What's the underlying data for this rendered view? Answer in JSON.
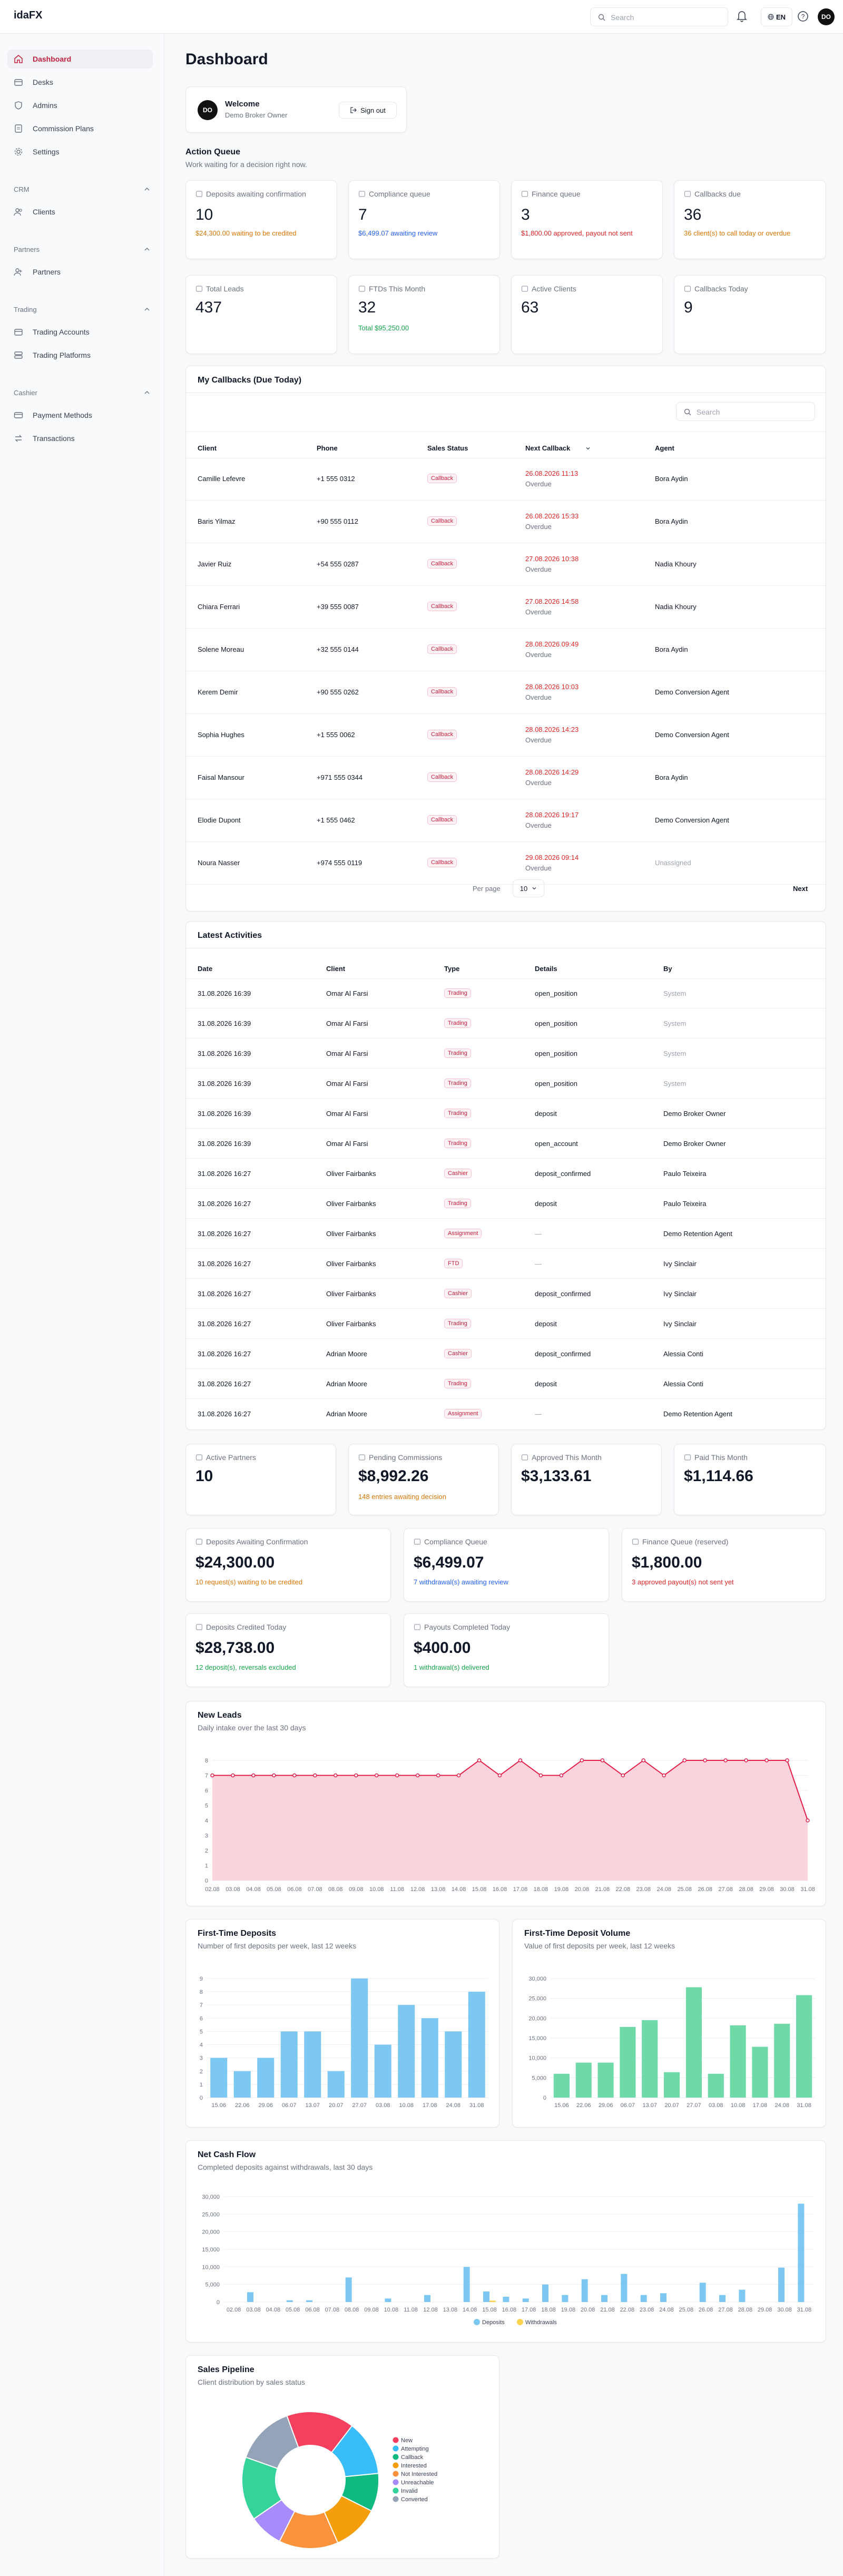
{
  "app": {
    "logo": "idaFX",
    "search_placeholder": "Search",
    "lang": "EN",
    "user_initials": "DO"
  },
  "sidebar": {
    "top": [
      {
        "label": "Dashboard"
      },
      {
        "label": "Desks"
      },
      {
        "label": "Admins"
      },
      {
        "label": "Commission Plans"
      },
      {
        "label": "Settings"
      }
    ],
    "crm": {
      "title": "CRM",
      "items": [
        {
          "label": "Clients"
        }
      ]
    },
    "partners": {
      "title": "Partners",
      "items": [
        {
          "label": "Partners"
        }
      ]
    },
    "trading": {
      "title": "Trading",
      "items": [
        {
          "label": "Trading Accounts"
        },
        {
          "label": "Trading Platforms"
        }
      ]
    },
    "cashier": {
      "title": "Cashier",
      "items": [
        {
          "label": "Payment Methods"
        },
        {
          "label": "Transactions"
        }
      ]
    }
  },
  "page": {
    "title": "Dashboard"
  },
  "welcome": {
    "title": "Welcome",
    "subtitle": "Demo Broker Owner",
    "initials": "DO",
    "signout": "Sign out"
  },
  "action_queue": {
    "title": "Action Queue",
    "subtitle": "Work waiting for a decision right now."
  },
  "queue_cards": [
    {
      "title": "Deposits awaiting confirmation",
      "value": "10",
      "sub": "$24,300.00 waiting to be credited",
      "sub_color": "orange"
    },
    {
      "title": "Compliance queue",
      "value": "7",
      "sub": "$6,499.07 awaiting review",
      "sub_color": "blue"
    },
    {
      "title": "Finance queue",
      "value": "3",
      "sub": "$1,800.00 approved, payout not sent",
      "sub_color": "red"
    },
    {
      "title": "Callbacks due",
      "value": "36",
      "sub": "36 client(s) to call today or overdue",
      "sub_color": "orange"
    }
  ],
  "kpi_cards": [
    {
      "title": "Total Leads",
      "value": "437",
      "sub": ""
    },
    {
      "title": "FTDs This Month",
      "value": "32",
      "sub": "Total $95,250.00"
    },
    {
      "title": "Active Clients",
      "value": "63",
      "sub": ""
    },
    {
      "title": "Callbacks Today",
      "value": "9",
      "sub": ""
    }
  ],
  "callbacks": {
    "title": "My Callbacks (Due Today)",
    "search_placeholder": "Search",
    "columns": [
      "Client",
      "Phone",
      "Sales Status",
      "Next Callback",
      "Agent"
    ],
    "rows": [
      {
        "client": "Camille Lefevre",
        "phone": "+1 555 0312",
        "status": "Callback",
        "date": "26.08.2026 11:13",
        "note": "Overdue",
        "agent": "Bora Aydin"
      },
      {
        "client": "Baris Yilmaz",
        "phone": "+90 555 0112",
        "status": "Callback",
        "date": "26.08.2026 15:33",
        "note": "Overdue",
        "agent": "Bora Aydin"
      },
      {
        "client": "Javier Ruiz",
        "phone": "+54 555 0287",
        "status": "Callback",
        "date": "27.08.2026 10:38",
        "note": "Overdue",
        "agent": "Nadia Khoury"
      },
      {
        "client": "Chiara Ferrari",
        "phone": "+39 555 0087",
        "status": "Callback",
        "date": "27.08.2026 14:58",
        "note": "Overdue",
        "agent": "Nadia Khoury"
      },
      {
        "client": "Solene Moreau",
        "phone": "+32 555 0144",
        "status": "Callback",
        "date": "28.08.2026 09:49",
        "note": "Overdue",
        "agent": "Bora Aydin"
      },
      {
        "client": "Kerem Demir",
        "phone": "+90 555 0262",
        "status": "Callback",
        "date": "28.08.2026 10:03",
        "note": "Overdue",
        "agent": "Demo Conversion Agent"
      },
      {
        "client": "Sophia Hughes",
        "phone": "+1 555 0062",
        "status": "Callback",
        "date": "28.08.2026 14:23",
        "note": "Overdue",
        "agent": "Demo Conversion Agent"
      },
      {
        "client": "Faisal Mansour",
        "phone": "+971 555 0344",
        "status": "Callback",
        "date": "28.08.2026 14:29",
        "note": "Overdue",
        "agent": "Bora Aydin"
      },
      {
        "client": "Elodie Dupont",
        "phone": "+1 555 0462",
        "status": "Callback",
        "date": "28.08.2026 19:17",
        "note": "Overdue",
        "agent": "Demo Conversion Agent"
      },
      {
        "client": "Noura Nasser",
        "phone": "+974 555 0119",
        "status": "Callback",
        "date": "29.08.2026 09:14",
        "note": "Overdue",
        "agent": "Unassigned"
      }
    ],
    "per_page_label": "Per page",
    "per_page": "10",
    "next": "Next"
  },
  "activities": {
    "title": "Latest Activities",
    "columns": [
      "Date",
      "Client",
      "Type",
      "Details",
      "By"
    ],
    "rows": [
      {
        "date": "31.08.2026 16:39",
        "client": "Omar Al Farsi",
        "type": "Trading",
        "details": "open_position",
        "by": "System"
      },
      {
        "date": "31.08.2026 16:39",
        "client": "Omar Al Farsi",
        "type": "Trading",
        "details": "open_position",
        "by": "System"
      },
      {
        "date": "31.08.2026 16:39",
        "client": "Omar Al Farsi",
        "type": "Trading",
        "details": "open_position",
        "by": "System"
      },
      {
        "date": "31.08.2026 16:39",
        "client": "Omar Al Farsi",
        "type": "Trading",
        "details": "open_position",
        "by": "System"
      },
      {
        "date": "31.08.2026 16:39",
        "client": "Omar Al Farsi",
        "type": "Trading",
        "details": "deposit",
        "by": "Demo Broker Owner"
      },
      {
        "date": "31.08.2026 16:39",
        "client": "Omar Al Farsi",
        "type": "Trading",
        "details": "open_account",
        "by": "Demo Broker Owner"
      },
      {
        "date": "31.08.2026 16:27",
        "client": "Oliver Fairbanks",
        "type": "Cashier",
        "details": "deposit_confirmed",
        "by": "Paulo Teixeira"
      },
      {
        "date": "31.08.2026 16:27",
        "client": "Oliver Fairbanks",
        "type": "Trading",
        "details": "deposit",
        "by": "Paulo Teixeira"
      },
      {
        "date": "31.08.2026 16:27",
        "client": "Oliver Fairbanks",
        "type": "Assignment",
        "details": "—",
        "by": "Demo Retention Agent"
      },
      {
        "date": "31.08.2026 16:27",
        "client": "Oliver Fairbanks",
        "type": "FTD",
        "details": "—",
        "by": "Ivy Sinclair"
      },
      {
        "date": "31.08.2026 16:27",
        "client": "Oliver Fairbanks",
        "type": "Cashier",
        "details": "deposit_confirmed",
        "by": "Ivy Sinclair"
      },
      {
        "date": "31.08.2026 16:27",
        "client": "Oliver Fairbanks",
        "type": "Trading",
        "details": "deposit",
        "by": "Ivy Sinclair"
      },
      {
        "date": "31.08.2026 16:27",
        "client": "Adrian Moore",
        "type": "Cashier",
        "details": "deposit_confirmed",
        "by": "Alessia Conti"
      },
      {
        "date": "31.08.2026 16:27",
        "client": "Adrian Moore",
        "type": "Trading",
        "details": "deposit",
        "by": "Alessia Conti"
      },
      {
        "date": "31.08.2026 16:27",
        "client": "Adrian Moore",
        "type": "Assignment",
        "details": "—",
        "by": "Demo Retention Agent"
      }
    ]
  },
  "partner_cards": [
    {
      "title": "Active Partners",
      "value": "10",
      "sub": ""
    },
    {
      "title": "Pending Commissions",
      "value": "$8,992.26",
      "sub": "148 entries awaiting decision"
    },
    {
      "title": "Approved This Month",
      "value": "$3,133.61",
      "sub": ""
    },
    {
      "title": "Paid This Month",
      "value": "$1,114.66",
      "sub": ""
    }
  ],
  "finance_cards": [
    {
      "title": "Deposits Awaiting Confirmation",
      "value": "$24,300.00",
      "sub": "10 request(s) waiting to be credited",
      "sub_color": "orange"
    },
    {
      "title": "Compliance Queue",
      "value": "$6,499.07",
      "sub": "7 withdrawal(s) awaiting review",
      "sub_color": "blue"
    },
    {
      "title": "Finance Queue (reserved)",
      "value": "$1,800.00",
      "sub": "3 approved payout(s) not sent yet",
      "sub_color": "red"
    },
    {
      "title": "Deposits Credited Today",
      "value": "$28,738.00",
      "sub": "12 deposit(s), reversals excluded",
      "sub_color": "green"
    },
    {
      "title": "Payouts Completed Today",
      "value": "$400.00",
      "sub": "1 withdrawal(s) delivered",
      "sub_color": "green"
    }
  ],
  "colors": {
    "accent": "#c2203f",
    "bar_blue": "#7cc8f2",
    "bar_green": "#6fd9a8",
    "line": "#e11d48",
    "area": "#fbd3dc",
    "withdraw": "#fcd34d"
  },
  "chart_data": [
    {
      "type": "area",
      "title": "New Leads",
      "subtitle": "Daily intake over the last 30 days",
      "x": [
        "02.08",
        "03.08",
        "04.08",
        "05.08",
        "06.08",
        "07.08",
        "08.08",
        "09.08",
        "10.08",
        "11.08",
        "12.08",
        "13.08",
        "14.08",
        "15.08",
        "16.08",
        "17.08",
        "18.08",
        "19.08",
        "20.08",
        "21.08",
        "22.08",
        "23.08",
        "24.08",
        "25.08",
        "26.08",
        "27.08",
        "28.08",
        "29.08",
        "30.08",
        "31.08"
      ],
      "values": [
        7,
        7,
        7,
        7,
        7,
        7,
        7,
        7,
        7,
        7,
        7,
        7,
        7,
        8,
        7,
        8,
        7,
        7,
        8,
        8,
        7,
        8,
        7,
        8,
        8,
        8,
        8,
        8,
        8,
        4
      ],
      "ylim": [
        0,
        8
      ],
      "yticks": [
        0,
        1,
        2,
        3,
        4,
        5,
        6,
        7,
        8
      ],
      "grid": true
    },
    {
      "type": "bar",
      "title": "First-Time Deposits",
      "subtitle": "Number of first deposits per week, last 12 weeks",
      "categories": [
        "15.06",
        "22.06",
        "29.06",
        "06.07",
        "13.07",
        "20.07",
        "27.07",
        "03.08",
        "10.08",
        "17.08",
        "24.08",
        "31.08"
      ],
      "values": [
        3,
        2,
        3,
        5,
        5,
        2,
        9,
        4,
        7,
        6,
        5,
        8
      ],
      "ylim": [
        0,
        9
      ],
      "yticks": [
        0,
        1,
        2,
        3,
        4,
        5,
        6,
        7,
        8,
        9
      ]
    },
    {
      "type": "bar",
      "title": "First-Time Deposit Volume",
      "subtitle": "Value of first deposits per week, last 12 weeks",
      "categories": [
        "15.06",
        "22.06",
        "29.06",
        "06.07",
        "13.07",
        "20.07",
        "27.07",
        "03.08",
        "10.08",
        "17.08",
        "24.08",
        "31.08"
      ],
      "values": [
        6000,
        8800,
        8800,
        17800,
        19500,
        6400,
        27800,
        6000,
        18200,
        12800,
        18600,
        25800
      ],
      "ylim": [
        0,
        30000
      ],
      "yticks": [
        0,
        5000,
        10000,
        15000,
        20000,
        25000,
        30000
      ]
    },
    {
      "type": "bar",
      "title": "Net Cash Flow",
      "subtitle": "Completed deposits against withdrawals, last 30 days",
      "categories": [
        "02.08",
        "03.08",
        "04.08",
        "05.08",
        "06.08",
        "07.08",
        "08.08",
        "09.08",
        "10.08",
        "11.08",
        "12.08",
        "13.08",
        "14.08",
        "15.08",
        "16.08",
        "17.08",
        "18.08",
        "19.08",
        "20.08",
        "21.08",
        "22.08",
        "23.08",
        "24.08",
        "25.08",
        "26.08",
        "27.08",
        "28.08",
        "29.08",
        "30.08",
        "31.08"
      ],
      "series": [
        {
          "name": "Deposits",
          "values": [
            0,
            2800,
            0,
            500,
            500,
            0,
            7000,
            0,
            1000,
            0,
            2000,
            0,
            10000,
            3000,
            1500,
            1000,
            5000,
            2000,
            6500,
            2000,
            8000,
            2000,
            2500,
            0,
            5500,
            2000,
            3500,
            0,
            9800,
            28000
          ]
        },
        {
          "name": "Withdrawals",
          "values": [
            0,
            0,
            0,
            0,
            0,
            0,
            0,
            0,
            0,
            0,
            0,
            0,
            0,
            400,
            0,
            0,
            0,
            0,
            0,
            0,
            0,
            0,
            0,
            0,
            0,
            0,
            0,
            0,
            0,
            0
          ]
        }
      ],
      "ylim": [
        0,
        30000
      ],
      "yticks": [
        0,
        5000,
        10000,
        15000,
        20000,
        25000,
        30000
      ]
    },
    {
      "type": "pie",
      "title": "Sales Pipeline",
      "subtitle": "Client distribution by sales status",
      "labels": [
        "New",
        "Attempting",
        "Callback",
        "Interested",
        "Not Interested",
        "Unreachable",
        "Invalid",
        "Converted"
      ],
      "values": [
        16,
        13,
        9,
        11,
        14,
        8,
        15,
        14
      ],
      "colors": [
        "#f43f5e",
        "#38bdf8",
        "#10b981",
        "#f59e0b",
        "#fb923c",
        "#a78bfa",
        "#34d399",
        "#94a3b8"
      ]
    }
  ]
}
